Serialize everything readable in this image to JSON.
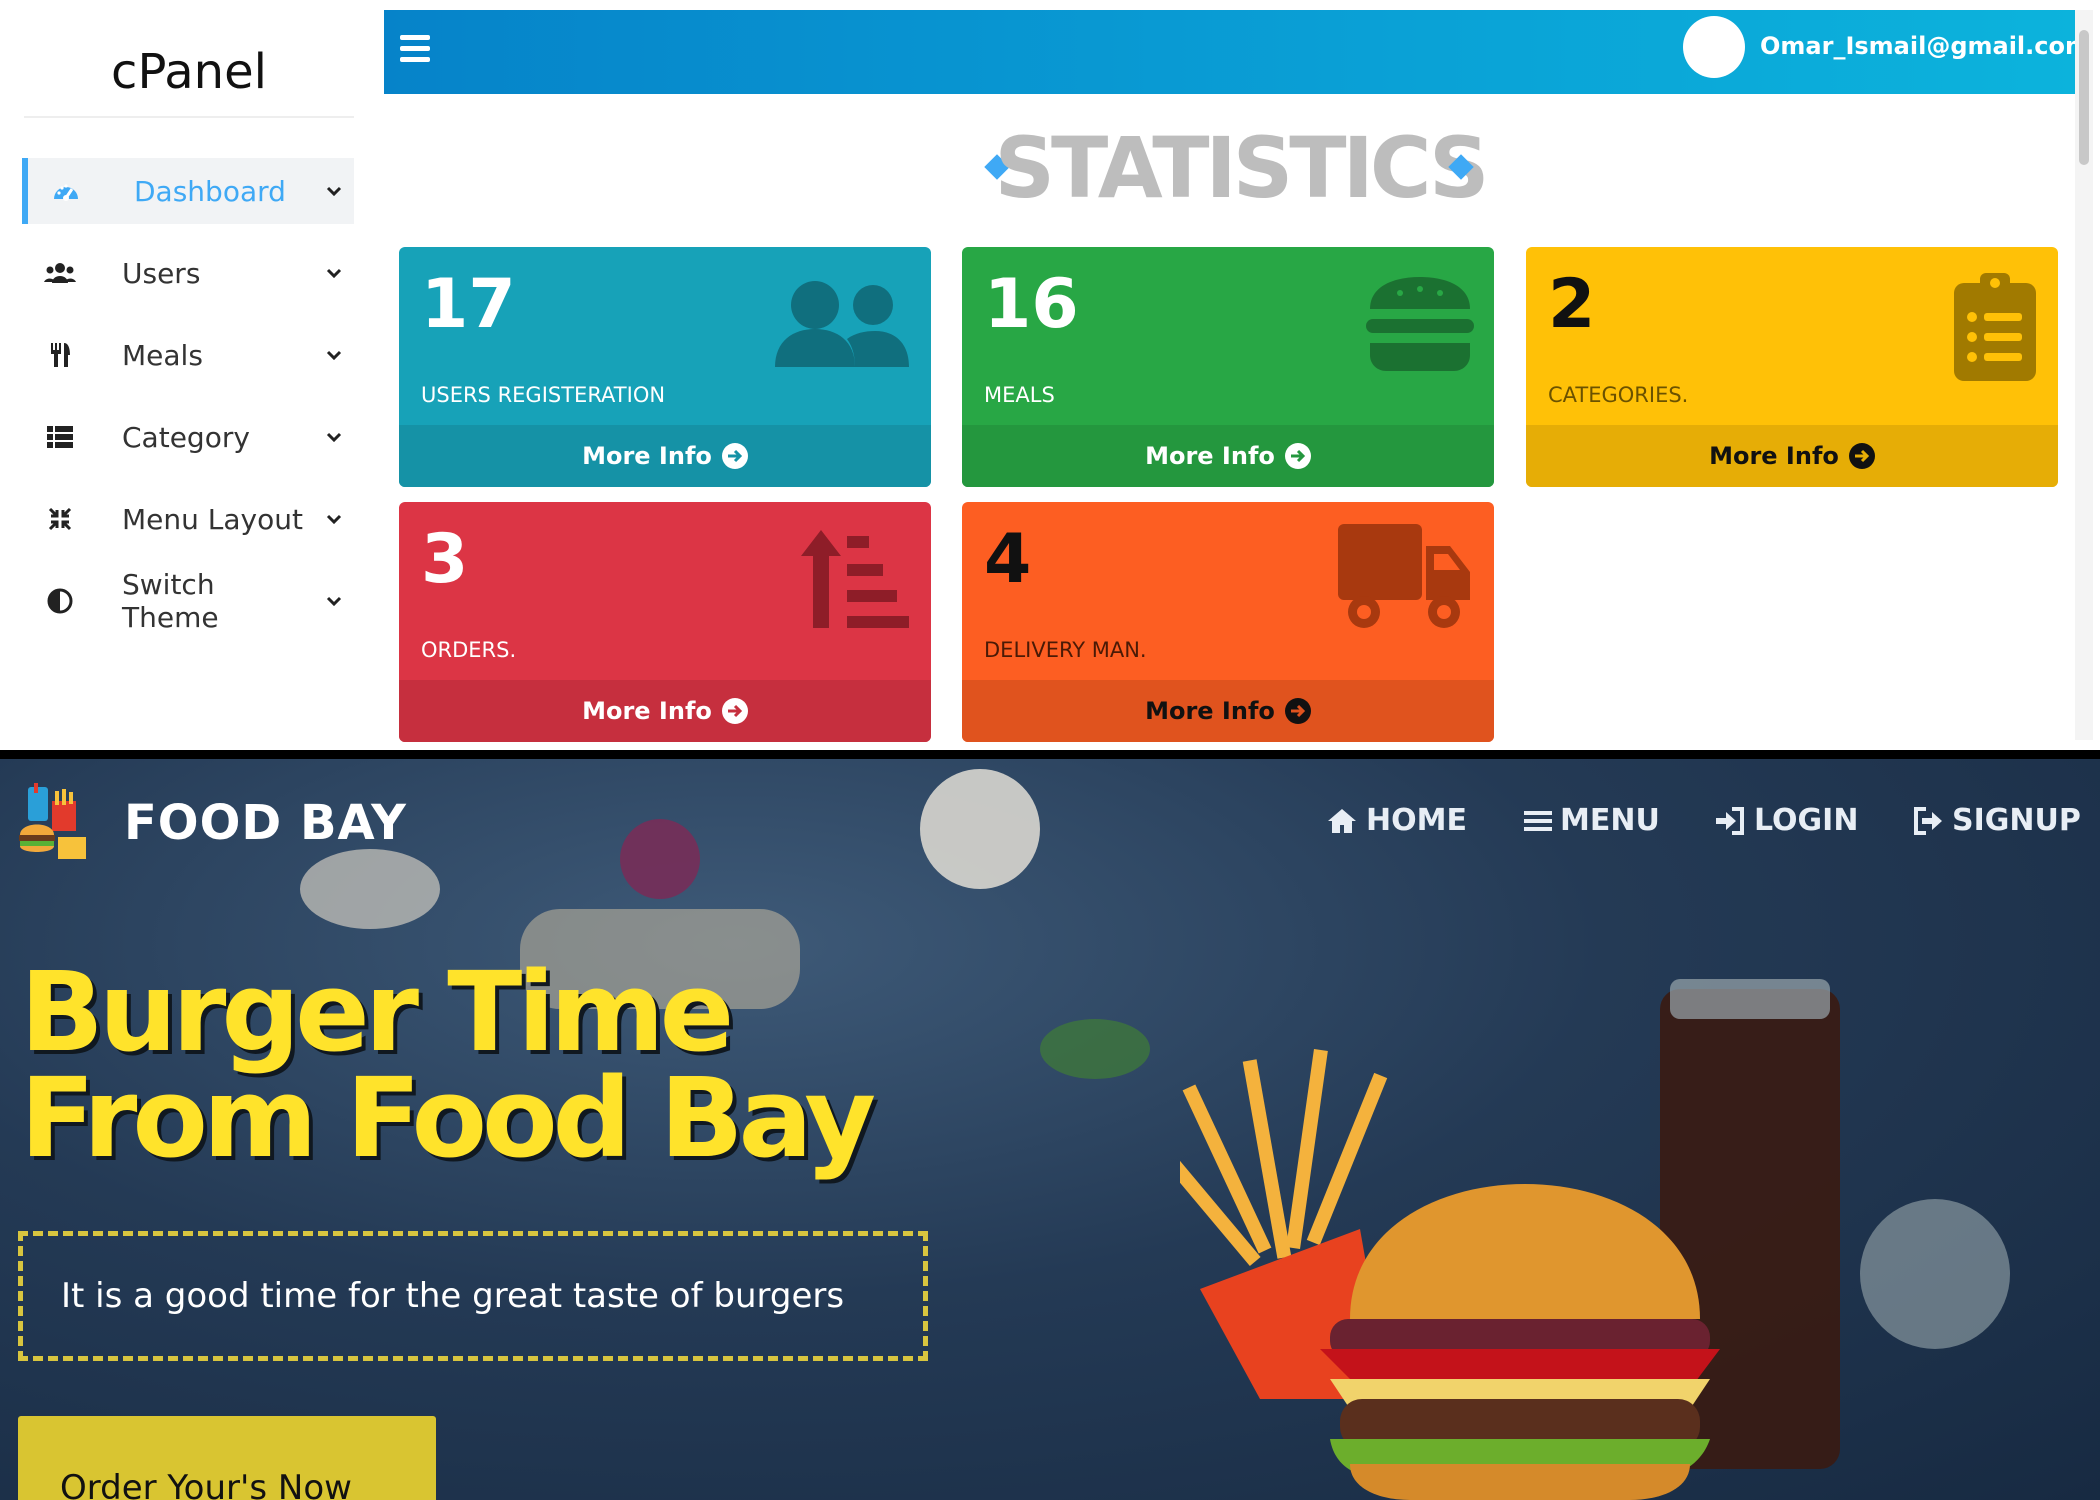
{
  "admin": {
    "brand": "cPanel",
    "user_email": "Omar_Ismail@gmail.com",
    "stats_title": "STATISTICS",
    "nav": [
      {
        "label": "Dashboard",
        "icon": "dashboard-icon",
        "active": true
      },
      {
        "label": "Users",
        "icon": "users-icon"
      },
      {
        "label": "Meals",
        "icon": "utensils-icon"
      },
      {
        "label": "Category",
        "icon": "list-icon"
      },
      {
        "label": "Menu Layout",
        "icon": "compress-icon"
      },
      {
        "label": "Switch Theme",
        "icon": "half-circle-icon"
      }
    ],
    "cards": [
      {
        "value": "17",
        "label": "USERS REGISTERATION",
        "more": "More Info",
        "icon": "users-icon",
        "color": "#17a2b8"
      },
      {
        "value": "16",
        "label": "MEALS",
        "more": "More Info",
        "icon": "burger-icon",
        "color": "#28a745"
      },
      {
        "value": "2",
        "label": "CATEGORIES.",
        "more": "More Info",
        "icon": "clipboard-list-icon",
        "color": "#ffc107"
      },
      {
        "value": "3",
        "label": "ORDERS.",
        "more": "More Info",
        "icon": "sort-up-icon",
        "color": "#dc3545"
      },
      {
        "value": "4",
        "label": "DELIVERY MAN.",
        "more": "More Info",
        "icon": "truck-icon",
        "color": "#fd5e22"
      }
    ]
  },
  "site": {
    "brand": "FOOD BAY",
    "nav": [
      {
        "label": "HOME",
        "icon": "home-icon"
      },
      {
        "label": "MENU",
        "icon": "menu-icon"
      },
      {
        "label": "LOGIN",
        "icon": "login-icon"
      },
      {
        "label": "SIGNUP",
        "icon": "signup-icon"
      }
    ],
    "headline_line1": "Burger Time",
    "headline_line2": "From Food Bay",
    "tagline": "It is a good time for the great taste of burgers",
    "cta": "Order Your's Now",
    "accent": "#ffe32b"
  }
}
